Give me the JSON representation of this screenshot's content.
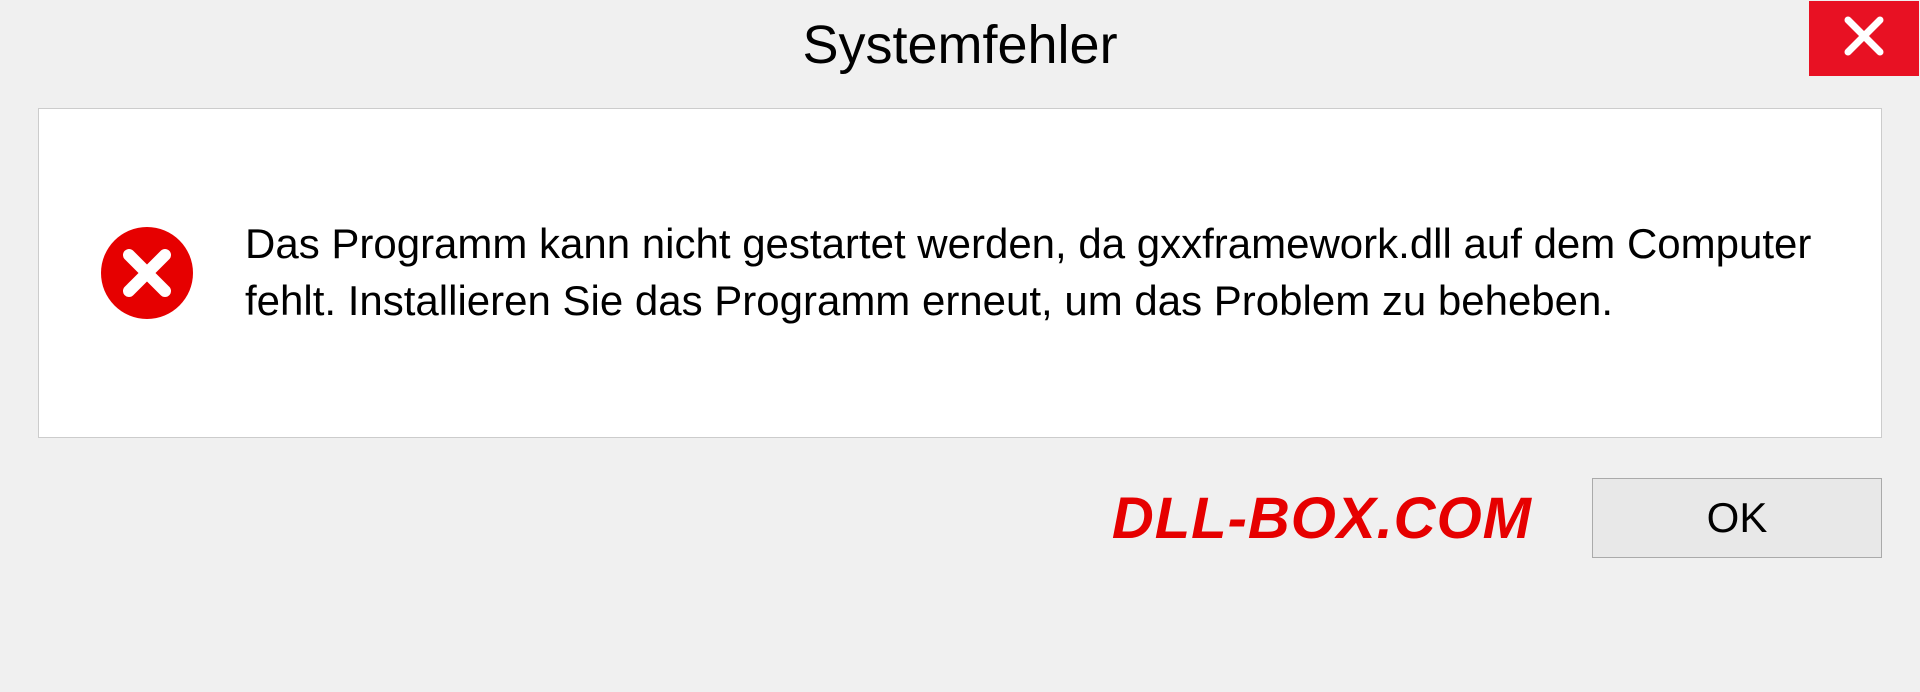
{
  "dialog": {
    "title": "Systemfehler",
    "message": "Das Programm kann nicht gestartet werden, da gxxframework.dll auf dem Computer fehlt. Installieren Sie das Programm erneut, um das Problem zu beheben.",
    "ok_label": "OK"
  },
  "watermark": "DLL-BOX.COM",
  "icons": {
    "close": "close-icon",
    "error": "error-icon"
  },
  "colors": {
    "close_bg": "#e81123",
    "error_red": "#e60000",
    "dialog_bg": "#f0f0f0",
    "content_bg": "#ffffff"
  }
}
